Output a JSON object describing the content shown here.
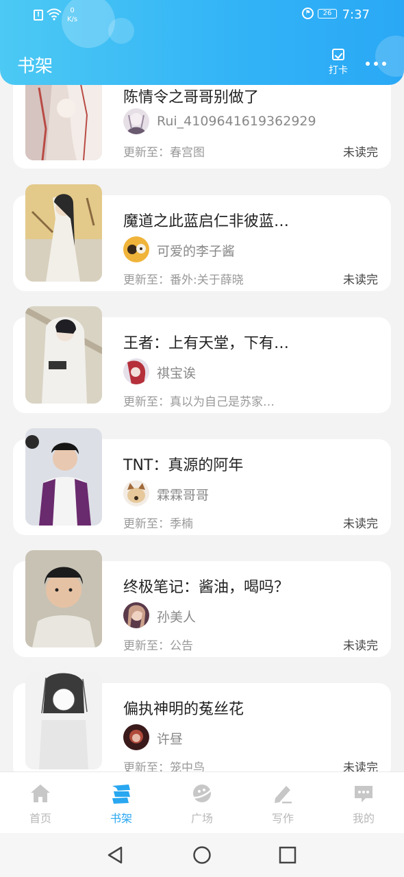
{
  "status_bar": {
    "network_speed": "0",
    "network_unit": "K/s",
    "battery": "26",
    "time": "7:37"
  },
  "header": {
    "title": "书架",
    "checkin_label": "打卡",
    "accent": "#2aa8f5"
  },
  "books": [
    {
      "title": "陈情令之哥哥别做了",
      "author": "Rui_4109641619362929",
      "update_prefix": "更新至：",
      "latest_chapter": "春宫图",
      "status": "未读完",
      "cover_colors": [
        "#e8dcd6",
        "#b94a44"
      ],
      "avatar_colors": [
        "#d8d0d6",
        "#6a5a70"
      ]
    },
    {
      "title": "魔道之此蓝启仁非彼蓝…",
      "author": "可爱的李子酱",
      "update_prefix": "更新至：",
      "latest_chapter": "番外:关于薛晓",
      "status": "未读完",
      "cover_colors": [
        "#e3c98a",
        "#5a5a5a"
      ],
      "avatar_colors": [
        "#f0b43a",
        "#7a4a20"
      ]
    },
    {
      "title": "王者：上有天堂，下有…",
      "author": "祺宝诶",
      "update_prefix": "更新至：",
      "latest_chapter": "真以为自己是苏家…",
      "status": "",
      "cover_colors": [
        "#d9d3c4",
        "#3a3a3a"
      ],
      "avatar_colors": [
        "#b5303a",
        "#4a1a2a"
      ]
    },
    {
      "title": "TNT：真源的阿年",
      "author": "霖霖哥哥",
      "update_prefix": "更新至：",
      "latest_chapter": "季楠",
      "status": "未读完",
      "cover_colors": [
        "#dcdfe6",
        "#6a2a6e"
      ],
      "avatar_colors": [
        "#e6c89a",
        "#a06a3a"
      ]
    },
    {
      "title": "终极笔记：酱油，喝吗？",
      "author": "孙美人",
      "update_prefix": "更新至：",
      "latest_chapter": "公告",
      "status": "未读完",
      "cover_colors": [
        "#c8c2b4",
        "#2a2a2a"
      ],
      "avatar_colors": [
        "#caa08a",
        "#5a3a4a"
      ]
    },
    {
      "title": "偏执神明的菟丝花",
      "author": "许昼",
      "update_prefix": "更新至：",
      "latest_chapter": "笼中鸟",
      "status": "未读完",
      "cover_colors": [
        "#f2f2f2",
        "#2a2a2a"
      ],
      "avatar_colors": [
        "#b04a3a",
        "#3a1a1a"
      ]
    }
  ],
  "tabs": [
    {
      "label": "首页",
      "icon": "home-icon"
    },
    {
      "label": "书架",
      "icon": "bookshelf-icon"
    },
    {
      "label": "广场",
      "icon": "planet-icon"
    },
    {
      "label": "写作",
      "icon": "pen-icon"
    },
    {
      "label": "我的",
      "icon": "chat-bubble-icon"
    }
  ],
  "active_tab": "书架"
}
